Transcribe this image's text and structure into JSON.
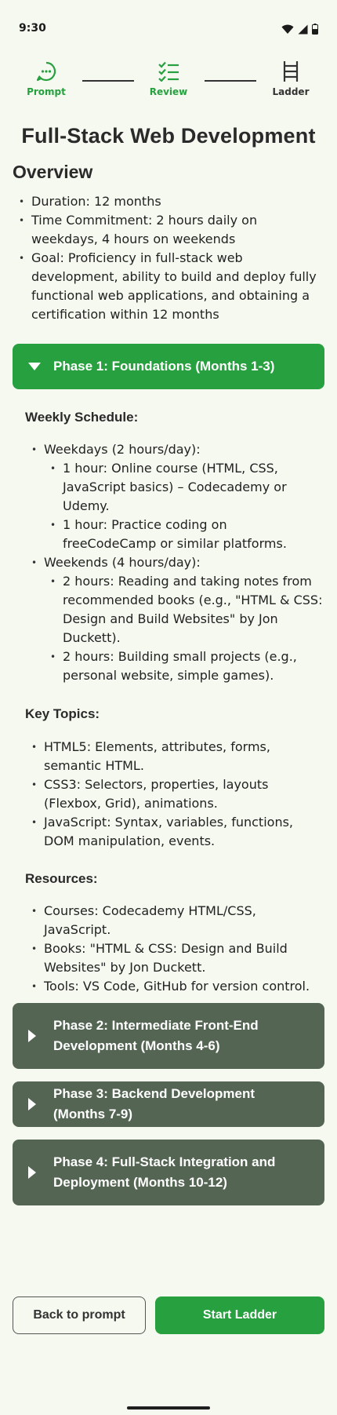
{
  "status": {
    "time": "9:30"
  },
  "stepper": {
    "steps": [
      {
        "label": "Prompt",
        "icon": "chat-bubble-icon",
        "color": "#27a03f"
      },
      {
        "label": "Review",
        "icon": "checklist-icon",
        "color": "#27a03f"
      },
      {
        "label": "Ladder",
        "icon": "ladder-icon",
        "color": "#333333"
      }
    ]
  },
  "title": "Full-Stack Web Development",
  "overview": {
    "heading": "Overview",
    "items": [
      "Duration: 12 months",
      "Time Commitment: 2 hours daily on weekdays, 4 hours on weekends",
      "Goal: Proficiency in full-stack web development, ability to build and deploy fully functional web applications, and obtaining a certification within 12 months"
    ]
  },
  "phase1": {
    "title": "Phase 1: Foundations (Months 1-3)",
    "weekly_schedule_label": "Weekly Schedule:",
    "weekdays": "Weekdays (2 hours/day):",
    "weekday_items": [
      "1 hour: Online course (HTML, CSS, JavaScript basics) – Codecademy or Udemy.",
      "1 hour: Practice coding on freeCodeCamp or similar platforms."
    ],
    "weekends": "Weekends (4 hours/day):",
    "weekend_items": [
      "2 hours: Reading and taking notes from recommended books (e.g., \"HTML & CSS: Design and Build Websites\" by Jon Duckett).",
      "2 hours: Building small projects (e.g., personal website, simple games)."
    ],
    "key_topics_label": "Key Topics:",
    "key_topics": [
      "HTML5: Elements, attributes, forms, semantic HTML.",
      "CSS3: Selectors, properties, layouts (Flexbox, Grid), animations.",
      "JavaScript: Syntax, variables, functions, DOM manipulation, events."
    ],
    "resources_label": "Resources:",
    "resources": [
      "Courses: Codecademy HTML/CSS, JavaScript.",
      "Books: \"HTML & CSS: Design and Build Websites\" by Jon Duckett.",
      "Tools: VS Code, GitHub for version control."
    ]
  },
  "phase2": {
    "title": "Phase 2: Intermediate Front-End Development (Months 4-6)"
  },
  "phase3": {
    "title": "Phase 3: Backend Development (Months 7-9)"
  },
  "phase4": {
    "title": "Phase 4: Full-Stack Integration and Deployment (Months 10-12)"
  },
  "buttons": {
    "back": "Back to prompt",
    "start": "Start Ladder"
  },
  "colors": {
    "accent": "#27a03f",
    "phase_collapsed": "#546653",
    "background": "#f5f9f0"
  }
}
